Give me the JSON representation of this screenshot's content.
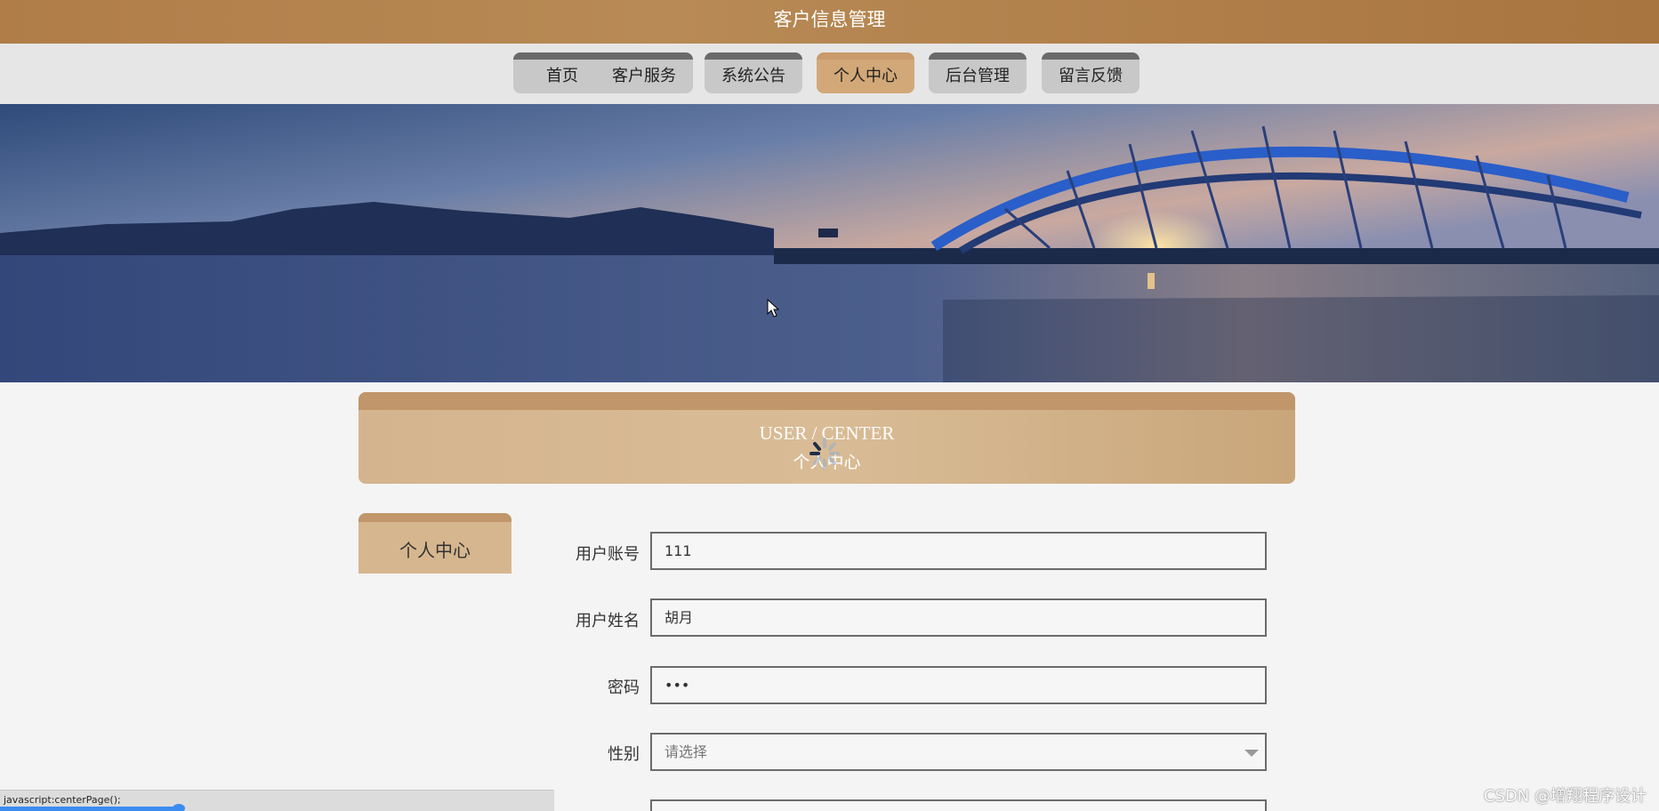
{
  "header": {
    "title": "客户信息管理"
  },
  "nav": {
    "items": [
      {
        "label": "首页"
      },
      {
        "label": "客户服务"
      },
      {
        "label": "系统公告"
      },
      {
        "label": "个人中心",
        "active": true
      },
      {
        "label": "后台管理"
      },
      {
        "label": "留言反馈"
      }
    ]
  },
  "section": {
    "title_en": "USER / CENTER",
    "title_cn": "个人中心"
  },
  "sidebar": {
    "tab_label": "个人中心"
  },
  "form": {
    "account": {
      "label": "用户账号",
      "value": "111"
    },
    "name": {
      "label": "用户姓名",
      "value": "胡月"
    },
    "password": {
      "label": "密码",
      "value": "•••"
    },
    "gender": {
      "label": "性别",
      "placeholder": "请选择"
    }
  },
  "status_bar": {
    "text": "javascript:centerPage();"
  },
  "watermark": {
    "text": "CSDN @增翔程序设计"
  },
  "colors": {
    "accent": "#c0966a",
    "nav_active": "#d2a878",
    "header": "#b07d48"
  }
}
